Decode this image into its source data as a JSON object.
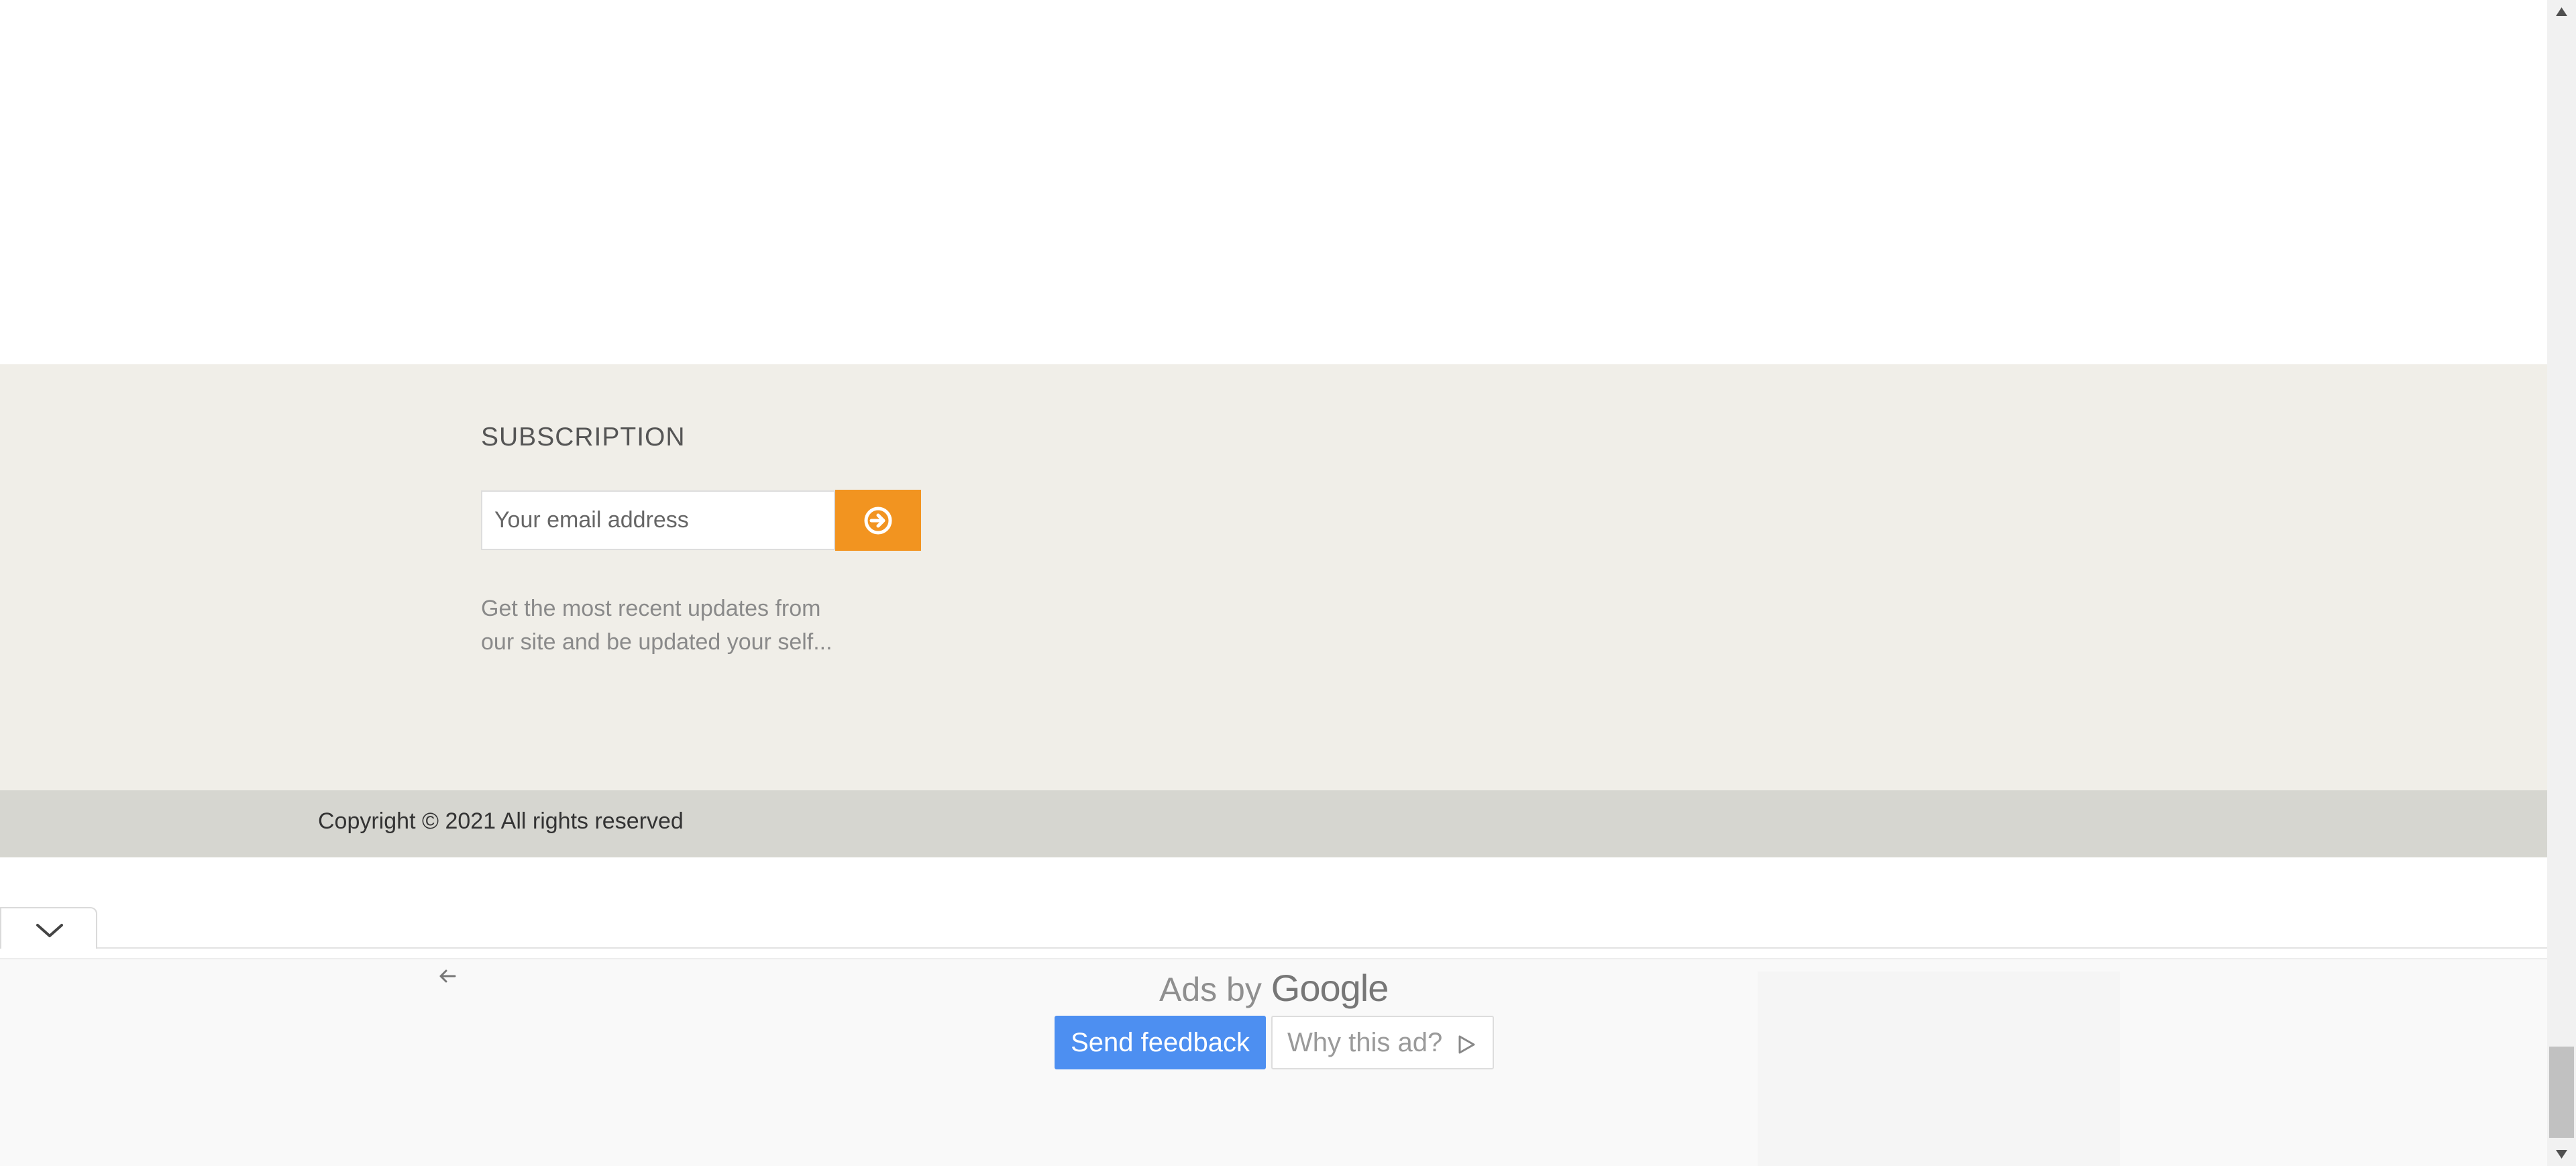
{
  "subscription": {
    "title": "SUBSCRIPTION",
    "email_placeholder": "Your email address",
    "submit_icon": "arrow-circle-right-icon",
    "description_line1": "Get the most recent updates from",
    "description_line2": "our site and be updated your self..."
  },
  "footer": {
    "copyright": "Copyright © 2021 All rights reserved"
  },
  "ad": {
    "ads_by": "Ads by",
    "brand": "Google",
    "send_feedback": "Send feedback",
    "why_this_ad": "Why this ad?",
    "collapse_icon": "chevron-down-icon",
    "back_icon": "arrow-left-icon",
    "why_icon": "play-triangle-icon"
  },
  "colors": {
    "subscription_bg": "#f0eee8",
    "copyright_bg": "#d6d6d0",
    "accent_orange": "#f29420",
    "feedback_blue": "#4d8ff1"
  }
}
